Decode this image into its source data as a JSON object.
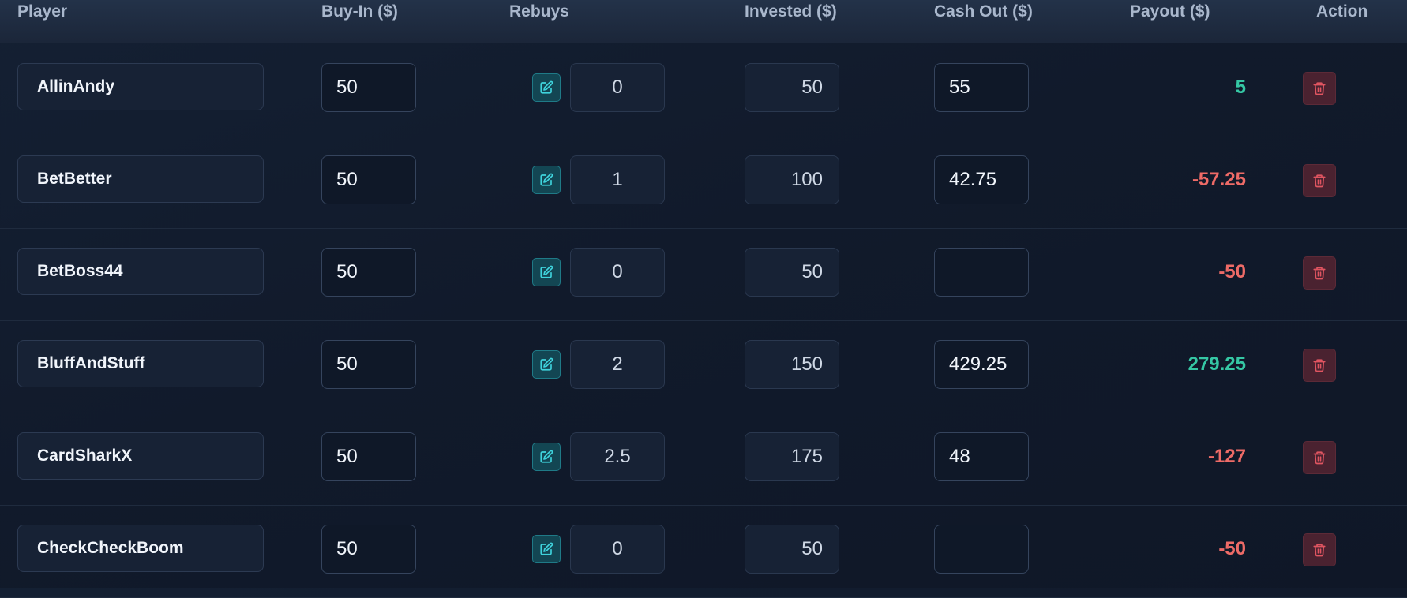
{
  "columns": {
    "player": "Player",
    "buy_in": "Buy-In ($)",
    "rebuys": "Rebuys",
    "invested": "Invested ($)",
    "cash_out": "Cash Out ($)",
    "payout": "Payout ($)",
    "action": "Action"
  },
  "colors": {
    "positive": "#35c7a4",
    "negative": "#ee6b67",
    "accent": "#1f7a87",
    "danger": "#e05561"
  },
  "icons": {
    "edit": "edit-icon",
    "delete": "trash-icon"
  },
  "rows": [
    {
      "player": "AllinAndy",
      "buy_in": "50",
      "rebuys": "0",
      "invested": "50",
      "cash_out": "55",
      "payout": "5",
      "sign": "positive"
    },
    {
      "player": "BetBetter",
      "buy_in": "50",
      "rebuys": "1",
      "invested": "100",
      "cash_out": "42.75",
      "payout": "-57.25",
      "sign": "negative"
    },
    {
      "player": "BetBoss44",
      "buy_in": "50",
      "rebuys": "0",
      "invested": "50",
      "cash_out": "",
      "payout": "-50",
      "sign": "negative"
    },
    {
      "player": "BluffAndStuff",
      "buy_in": "50",
      "rebuys": "2",
      "invested": "150",
      "cash_out": "429.25",
      "payout": "279.25",
      "sign": "positive"
    },
    {
      "player": "CardSharkX",
      "buy_in": "50",
      "rebuys": "2.5",
      "invested": "175",
      "cash_out": "48",
      "payout": "-127",
      "sign": "negative"
    },
    {
      "player": "CheckCheckBoom",
      "buy_in": "50",
      "rebuys": "0",
      "invested": "50",
      "cash_out": "",
      "payout": "-50",
      "sign": "negative"
    }
  ]
}
